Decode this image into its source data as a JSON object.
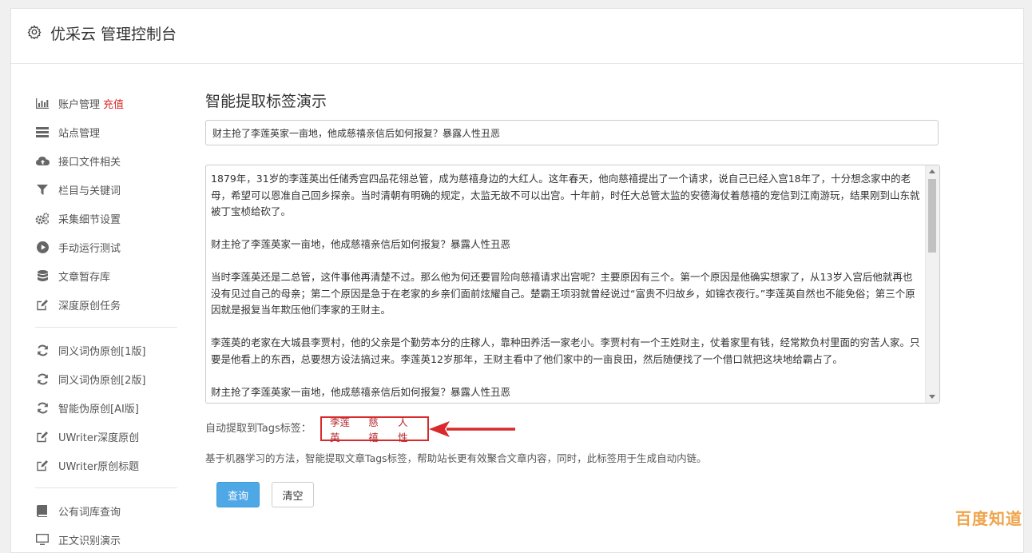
{
  "header": {
    "title": "优采云 管理控制台"
  },
  "sidebar": {
    "items": [
      {
        "label": "账户管理",
        "badge": "充值",
        "icon": "bar-chart-icon"
      },
      {
        "label": "站点管理",
        "icon": "list-icon"
      },
      {
        "label": "接口文件相关",
        "icon": "cloud-upload-icon"
      },
      {
        "label": "栏目与关键词",
        "icon": "filter-icon"
      },
      {
        "label": "采集细节设置",
        "icon": "gears-icon"
      },
      {
        "label": "手动运行测试",
        "icon": "play-icon"
      },
      {
        "label": "文章暂存库",
        "icon": "database-icon"
      },
      {
        "label": "深度原创任务",
        "icon": "edit-icon"
      },
      {
        "label": "同义词伪原创[1版]",
        "icon": "refresh-icon"
      },
      {
        "label": "同义词伪原创[2版]",
        "icon": "refresh-icon"
      },
      {
        "label": "智能伪原创[AI版]",
        "icon": "refresh-icon"
      },
      {
        "label": "UWriter深度原创",
        "icon": "edit-icon"
      },
      {
        "label": "UWriter原创标题",
        "icon": "edit-icon"
      },
      {
        "label": "公有词库查询",
        "icon": "book-icon"
      },
      {
        "label": "正文识别演示",
        "icon": "monitor-icon"
      }
    ]
  },
  "main": {
    "page_title": "智能提取标签演示",
    "title_input_value": "财主抢了李莲英家一亩地，他成慈禧亲信后如何报复？暴露人性丑恶",
    "article_paragraphs": [
      "1879年，31岁的李莲英出任储秀宫四品花翎总管，成为慈禧身边的大红人。这年春天，他向慈禧提出了一个请求，说自己已经入宫18年了，十分想念家中的老母，希望可以恩准自己回乡探亲。当时清朝有明确的规定，太监无故不可以出宫。十年前，时任大总管太监的安德海仗着慈禧的宠信到江南游玩，结果刚到山东就被丁宝桢给砍了。",
      "财主抢了李莲英家一亩地，他成慈禧亲信后如何报复？暴露人性丑恶",
      "当时李莲英还是二总管，这件事他再清楚不过。那么他为何还要冒险向慈禧请求出宫呢？主要原因有三个。第一个原因是他确实想家了，从13岁入宫后他就再也没有见过自己的母亲；第二个原因是急于在老家的乡亲们面前炫耀自己。楚霸王项羽就曾经说过“富贵不归故乡，如锦衣夜行。”李莲英自然也不能免俗；第三个原因就是报复当年欺压他们李家的王财主。",
      "李莲英的老家在大城县李贾村，他的父亲是个勤劳本分的庄稼人，靠种田养活一家老小。李贾村有一个王姓财主，仗着家里有钱，经常欺负村里面的穷苦人家。只要是他看上的东西，总要想方设法搞过来。李莲英12岁那年，王财主看中了他们家中的一亩良田，然后随便找了一个借口就把这块地给霸占了。",
      "财主抢了李莲英家一亩地，他成慈禧亲信后如何报复？暴露人性丑恶"
    ],
    "tags_label": "自动提取到Tags标签：",
    "tags": [
      "李莲英",
      "慈禧",
      "人性"
    ],
    "description": "基于机器学习的方法，智能提取文章Tags标签，帮助站长更有效聚合文章内容，同时，此标签用于生成自动内链。",
    "query_button": "查询",
    "clear_button": "清空"
  },
  "watermark": "百度知道",
  "colors": {
    "accent": "#4fa8e6",
    "badge": "#d9292b",
    "highlight_border": "#d9292b"
  }
}
